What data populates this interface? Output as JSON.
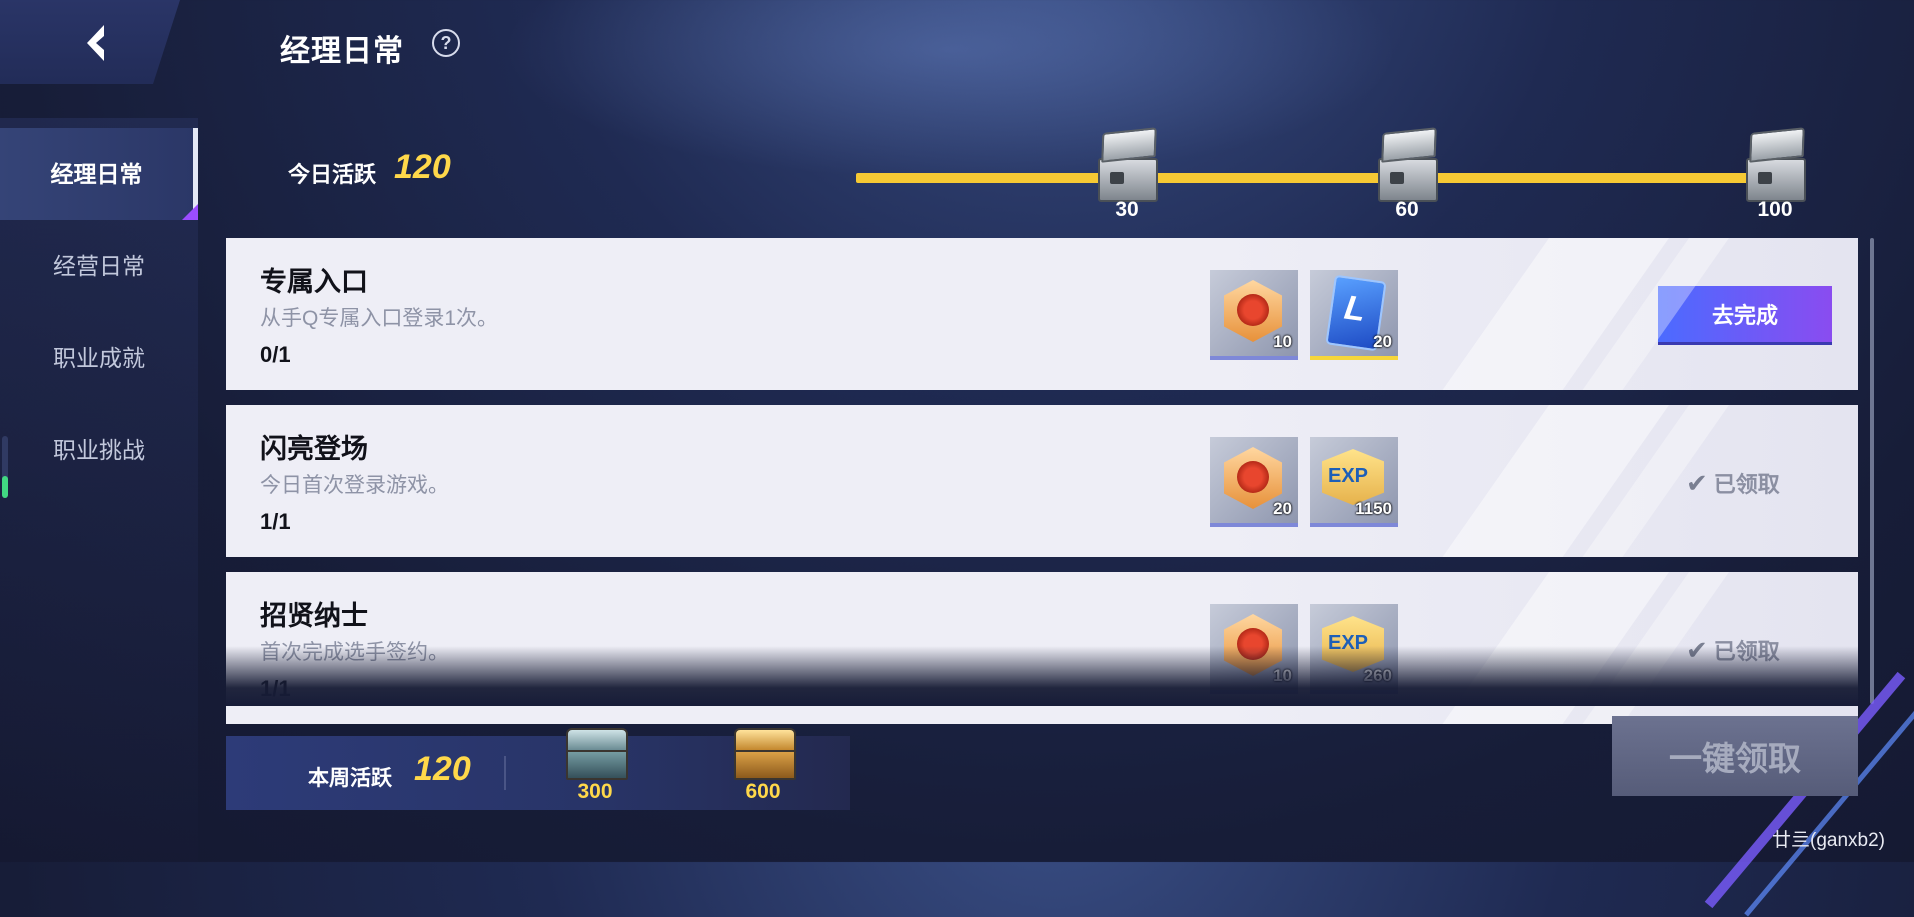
{
  "header": {
    "title": "经理日常",
    "help_icon": "question-circle-icon",
    "back_icon": "back-arrow-icon"
  },
  "sidebar": {
    "items": [
      {
        "label": "经理日常",
        "active": true
      },
      {
        "label": "经营日常",
        "active": false
      },
      {
        "label": "职业成就",
        "active": false
      },
      {
        "label": "职业挑战",
        "active": false
      }
    ]
  },
  "daily_activity": {
    "label": "今日活跃",
    "value": "120",
    "milestones": [
      {
        "threshold": "30",
        "icon": "silver-chest-open-icon"
      },
      {
        "threshold": "60",
        "icon": "silver-chest-open-icon"
      },
      {
        "threshold": "100",
        "icon": "silver-chest-open-icon"
      }
    ]
  },
  "tasks": [
    {
      "title": "专属入口",
      "desc": "从手Q专属入口登录1次。",
      "progress": "0/1",
      "rewards": [
        {
          "icon": "medal-coin-icon",
          "qty": "10"
        },
        {
          "icon": "lpl-card-icon",
          "qty": "20"
        }
      ],
      "action": "去完成",
      "status": "incomplete"
    },
    {
      "title": "闪亮登场",
      "desc": "今日首次登录游戏。",
      "progress": "1/1",
      "rewards": [
        {
          "icon": "medal-coin-icon",
          "qty": "20"
        },
        {
          "icon": "exp-badge-icon",
          "qty": "1150"
        }
      ],
      "action": "已领取",
      "status": "claimed"
    },
    {
      "title": "招贤纳士",
      "desc": "首次完成选手签约。",
      "progress": "1/1",
      "rewards": [
        {
          "icon": "medal-coin-icon",
          "qty": "10"
        },
        {
          "icon": "exp-badge-icon",
          "qty": "260"
        }
      ],
      "action": "已领取",
      "status": "claimed"
    }
  ],
  "weekly_activity": {
    "label": "本周活跃",
    "value": "120",
    "milestones": [
      {
        "threshold": "300",
        "icon": "silver-chest-icon"
      },
      {
        "threshold": "600",
        "icon": "gold-chest-icon"
      }
    ]
  },
  "claim_all_button": "一键领取",
  "watermark": "廿亖(ganxb2)",
  "colors": {
    "accent_gold": "#ffd84a",
    "progress_bar": "#f6c934",
    "primary_button": "#6a5cf5",
    "active_tab_marker": "#9b4dff"
  }
}
